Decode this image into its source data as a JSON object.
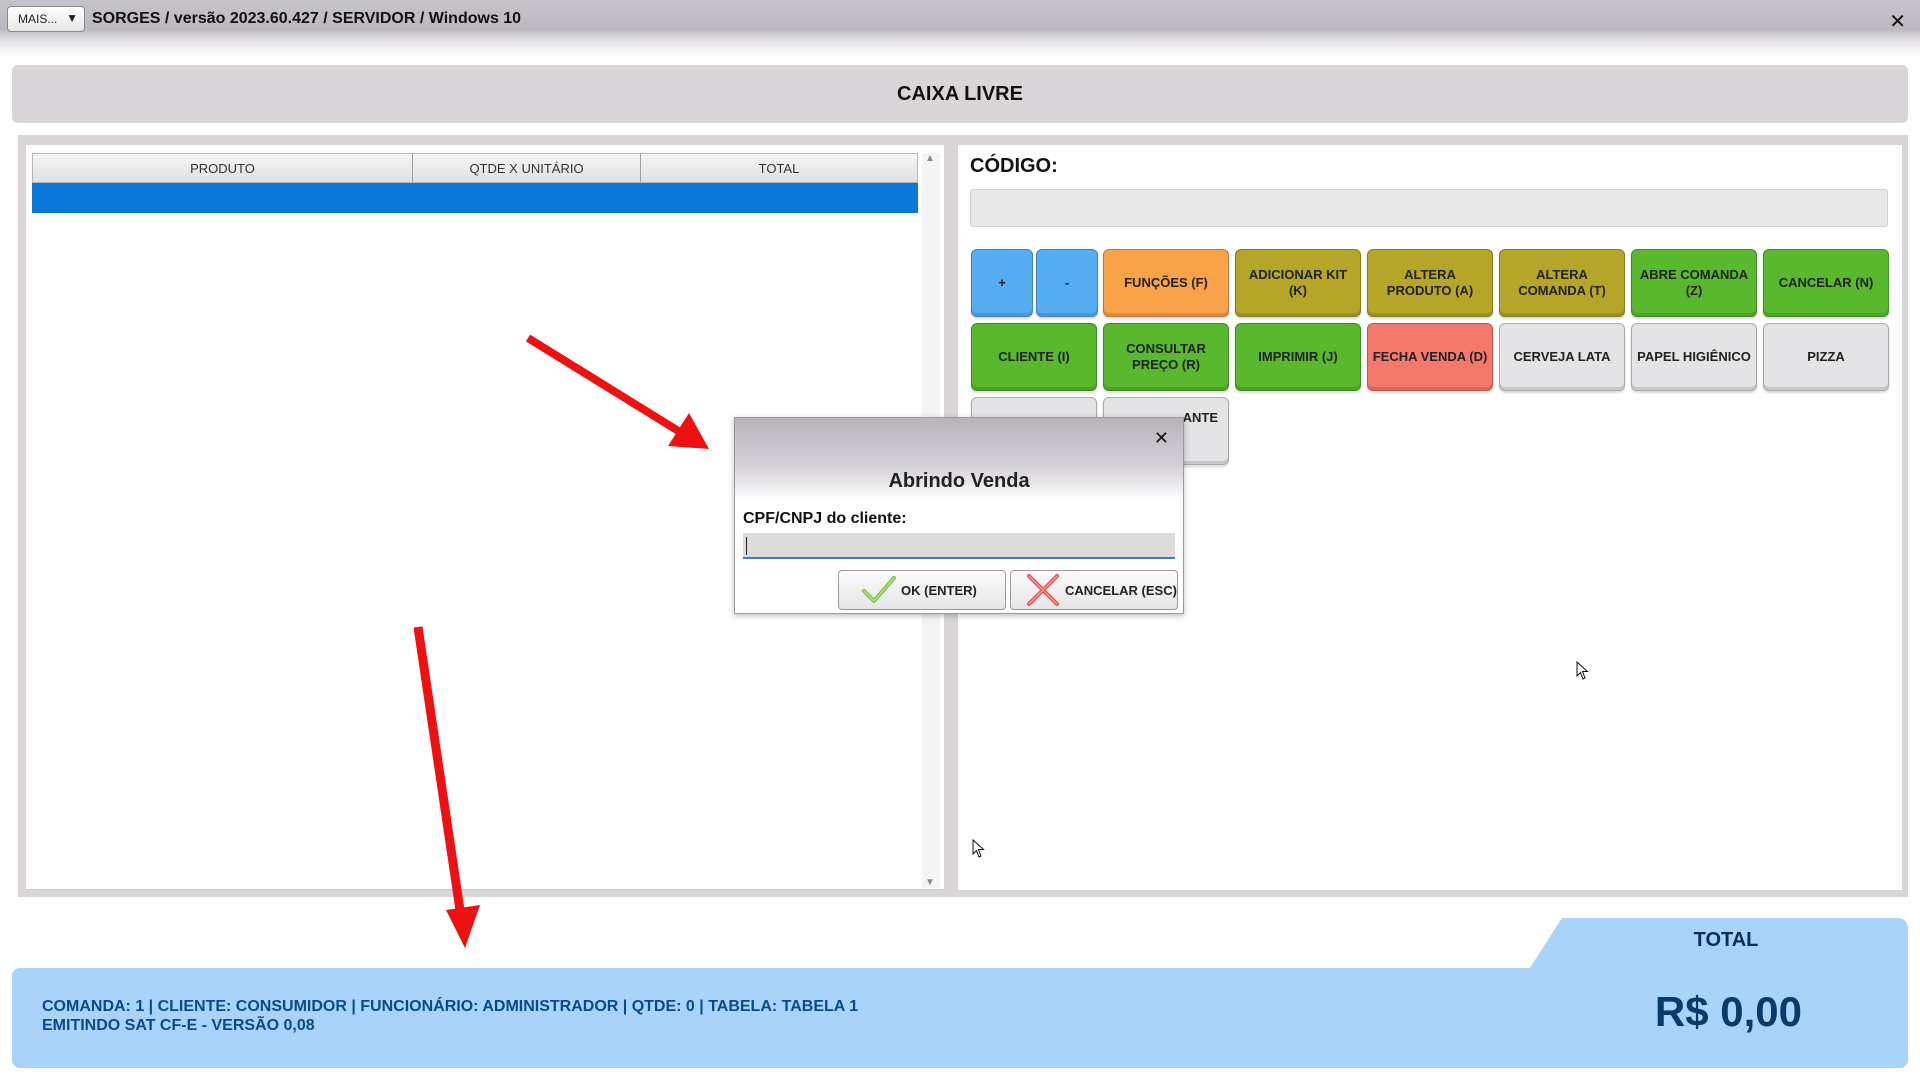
{
  "titlebar": {
    "menu_label": "MAIS...",
    "menu_arrow": "▼",
    "title": "SORGES / versão 2023.60.427 / SERVIDOR / Windows 10",
    "close": "✕"
  },
  "status": "CAIXA LIVRE",
  "table": {
    "columns": [
      "PRODUTO",
      "QTDE X UNITÁRIO",
      "TOTAL"
    ]
  },
  "code": {
    "label": "CÓDIGO:",
    "value": ""
  },
  "buttons": [
    {
      "label": "+",
      "color": "#57adf2"
    },
    {
      "label": "-",
      "color": "#57adf2"
    },
    {
      "label": "FUNÇÕES (F)",
      "color": "#f8a24a"
    },
    {
      "label": "ADICIONAR KIT (K)",
      "color": "#b5a629"
    },
    {
      "label": "ALTERA PRODUTO (A)",
      "color": "#b5a629"
    },
    {
      "label": "ALTERA COMANDA (T)",
      "color": "#b5a629"
    },
    {
      "label": "ABRE COMANDA (Z)",
      "color": "#5ab82e"
    },
    {
      "label": "CANCELAR (N)",
      "color": "#5ab82e"
    },
    {
      "label": "CLIENTE (I)",
      "color": "#5ab82e"
    },
    {
      "label": "CONSULTAR PREÇO (R)",
      "color": "#5ab82e"
    },
    {
      "label": "IMPRIMIR (J)",
      "color": "#5ab82e"
    },
    {
      "label": "FECHA VENDA (D)",
      "color": "#f6786d"
    },
    {
      "label": "CERVEJA LATA",
      "color": "#e4e3e5"
    },
    {
      "label": "PAPEL HIGIÊNICO",
      "color": "#e4e3e5"
    },
    {
      "label": "PIZZA",
      "color": "#e4e3e5"
    },
    {
      "label": "",
      "color": "#e4e3e5"
    },
    {
      "label": "ANTE",
      "color": "#e4e3e5"
    }
  ],
  "dialog": {
    "close": "✕",
    "title": "Abrindo Venda",
    "field_label": "CPF/CNPJ do cliente:",
    "field_value": "",
    "ok_label": "OK (ENTER)",
    "cancel_label": "CANCELAR (ESC)"
  },
  "footer": {
    "total_label": "TOTAL",
    "line1": "COMANDA: 1  |  CLIENTE: CONSUMIDOR  |  FUNCIONÁRIO: ADMINISTRADOR  |  QTDE: 0  |  TABELA: TABELA 1",
    "line2": "EMITINDO SAT CF-E - VERSÃO 0,08",
    "total_value": "R$ 0,00"
  },
  "colors": {
    "accent_blue": "#0a78d8",
    "footer_bg": "#a9d3f8",
    "annotation_arrow": "#ee1111"
  },
  "icons": {
    "ok": "check-icon",
    "cancel": "x-mark-icon"
  }
}
